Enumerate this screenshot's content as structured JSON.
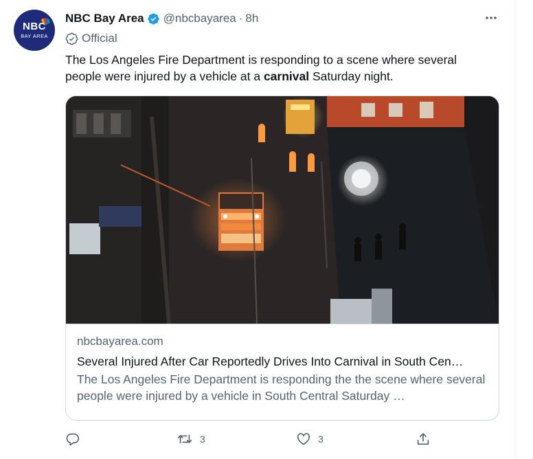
{
  "account": {
    "display_name": "NBC Bay Area",
    "handle": "@nbcbayarea",
    "separator": "·",
    "time": "8h",
    "label": "Official",
    "avatar_text": "NBC",
    "avatar_subtext": "BAY AREA"
  },
  "tweet": {
    "text_before": "The Los Angeles Fire Department is responding to a scene where several people were injured by a vehicle at a ",
    "text_bold": "carnival",
    "text_after": " Saturday night."
  },
  "card": {
    "domain": "nbcbayarea.com",
    "title": "Several Injured After Car Reportedly Drives Into Carnival in South Cen…",
    "description": "The Los Angeles Fire Department is responding the the scene where several people were injured by a vehicle in South Central Saturday …"
  },
  "actions": {
    "reply_count": "",
    "retweet_count": "3",
    "like_count": "3",
    "share_count": ""
  },
  "icons": {
    "verified": "verified-badge-icon",
    "official": "official-check-icon",
    "more": "more-options-icon",
    "reply": "reply-icon",
    "retweet": "retweet-icon",
    "like": "heart-icon",
    "share": "share-icon"
  },
  "colors": {
    "verified": "#1d9bf0",
    "secondary_text": "#536471",
    "primary_text": "#0f1419",
    "border": "#cfd9de",
    "avatar_bg": "#1d2b7a"
  }
}
